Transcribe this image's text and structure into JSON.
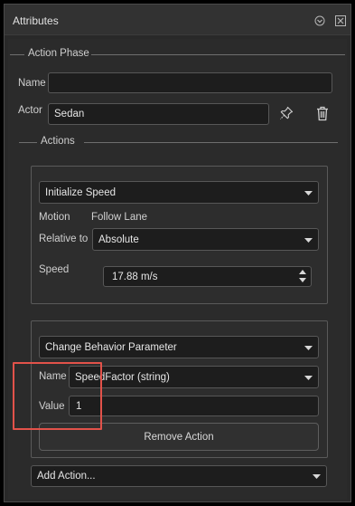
{
  "panel": {
    "title": "Attributes",
    "controls": [
      "minimize-icon",
      "close-icon"
    ]
  },
  "action_phase": {
    "legend": "Action Phase",
    "name_label": "Name",
    "name_value": "",
    "actor_label": "Actor",
    "actor_value": "Sedan",
    "icons": [
      "pin-icon",
      "trash-icon"
    ]
  },
  "actions": {
    "legend": "Actions",
    "action1": {
      "type": "Initialize Speed",
      "motion_label": "Motion",
      "motion_value": "Follow Lane",
      "relative_label": "Relative to",
      "relative_value": "Absolute",
      "speed_label": "Speed",
      "speed_value": "17.88 m/s"
    },
    "action2": {
      "type": "Change Behavior Parameter",
      "name_label": "Name",
      "name_value": "SpeedFactor (string)",
      "value_label": "Value",
      "value_value": "1",
      "remove_label": "Remove Action"
    },
    "add_action": "Add Action..."
  },
  "colors": {
    "highlight": "#e2524a",
    "panel_bg": "#292929",
    "field_bg": "#1d1d1d"
  }
}
